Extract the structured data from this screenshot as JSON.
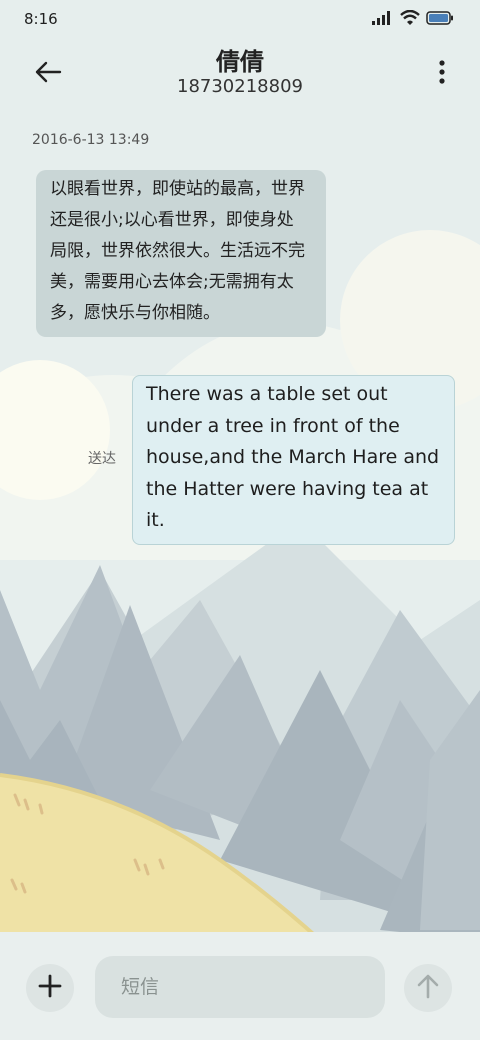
{
  "status_bar": {
    "time": "8:16",
    "icons": [
      "signal-icon",
      "wifi-icon",
      "battery-icon"
    ]
  },
  "header": {
    "contact_name": "倩倩",
    "phone_number": "18730218809",
    "back_icon": "arrow-left-icon",
    "more_icon": "more-vertical-icon"
  },
  "conversation": {
    "timestamp": "2016-6-13 13:49",
    "messages": [
      {
        "direction": "incoming",
        "lines": [
          "以眼看世界，即使站的最高，世界",
          "还是很小;以心看世界，即使身处",
          "局限，世界依然很大。生活远不完",
          "美，需要用心去体会;无需拥有太",
          "多，愿快乐与你相随。"
        ]
      },
      {
        "direction": "outgoing",
        "status": "送达",
        "lines": [
          "There was a table set out",
          "under a tree in front of the",
          "house,and the March Hare and",
          "the Hatter were having tea at",
          "it."
        ]
      }
    ]
  },
  "composer": {
    "placeholder": "短信",
    "value": "",
    "add_icon": "plus-icon",
    "send_icon": "arrow-up-icon"
  },
  "colors": {
    "incoming_bubble": "#c9d6d6",
    "outgoing_bubble": "#dfeff2",
    "mountains": "#b0bec5",
    "hill": "#efe1a5"
  }
}
